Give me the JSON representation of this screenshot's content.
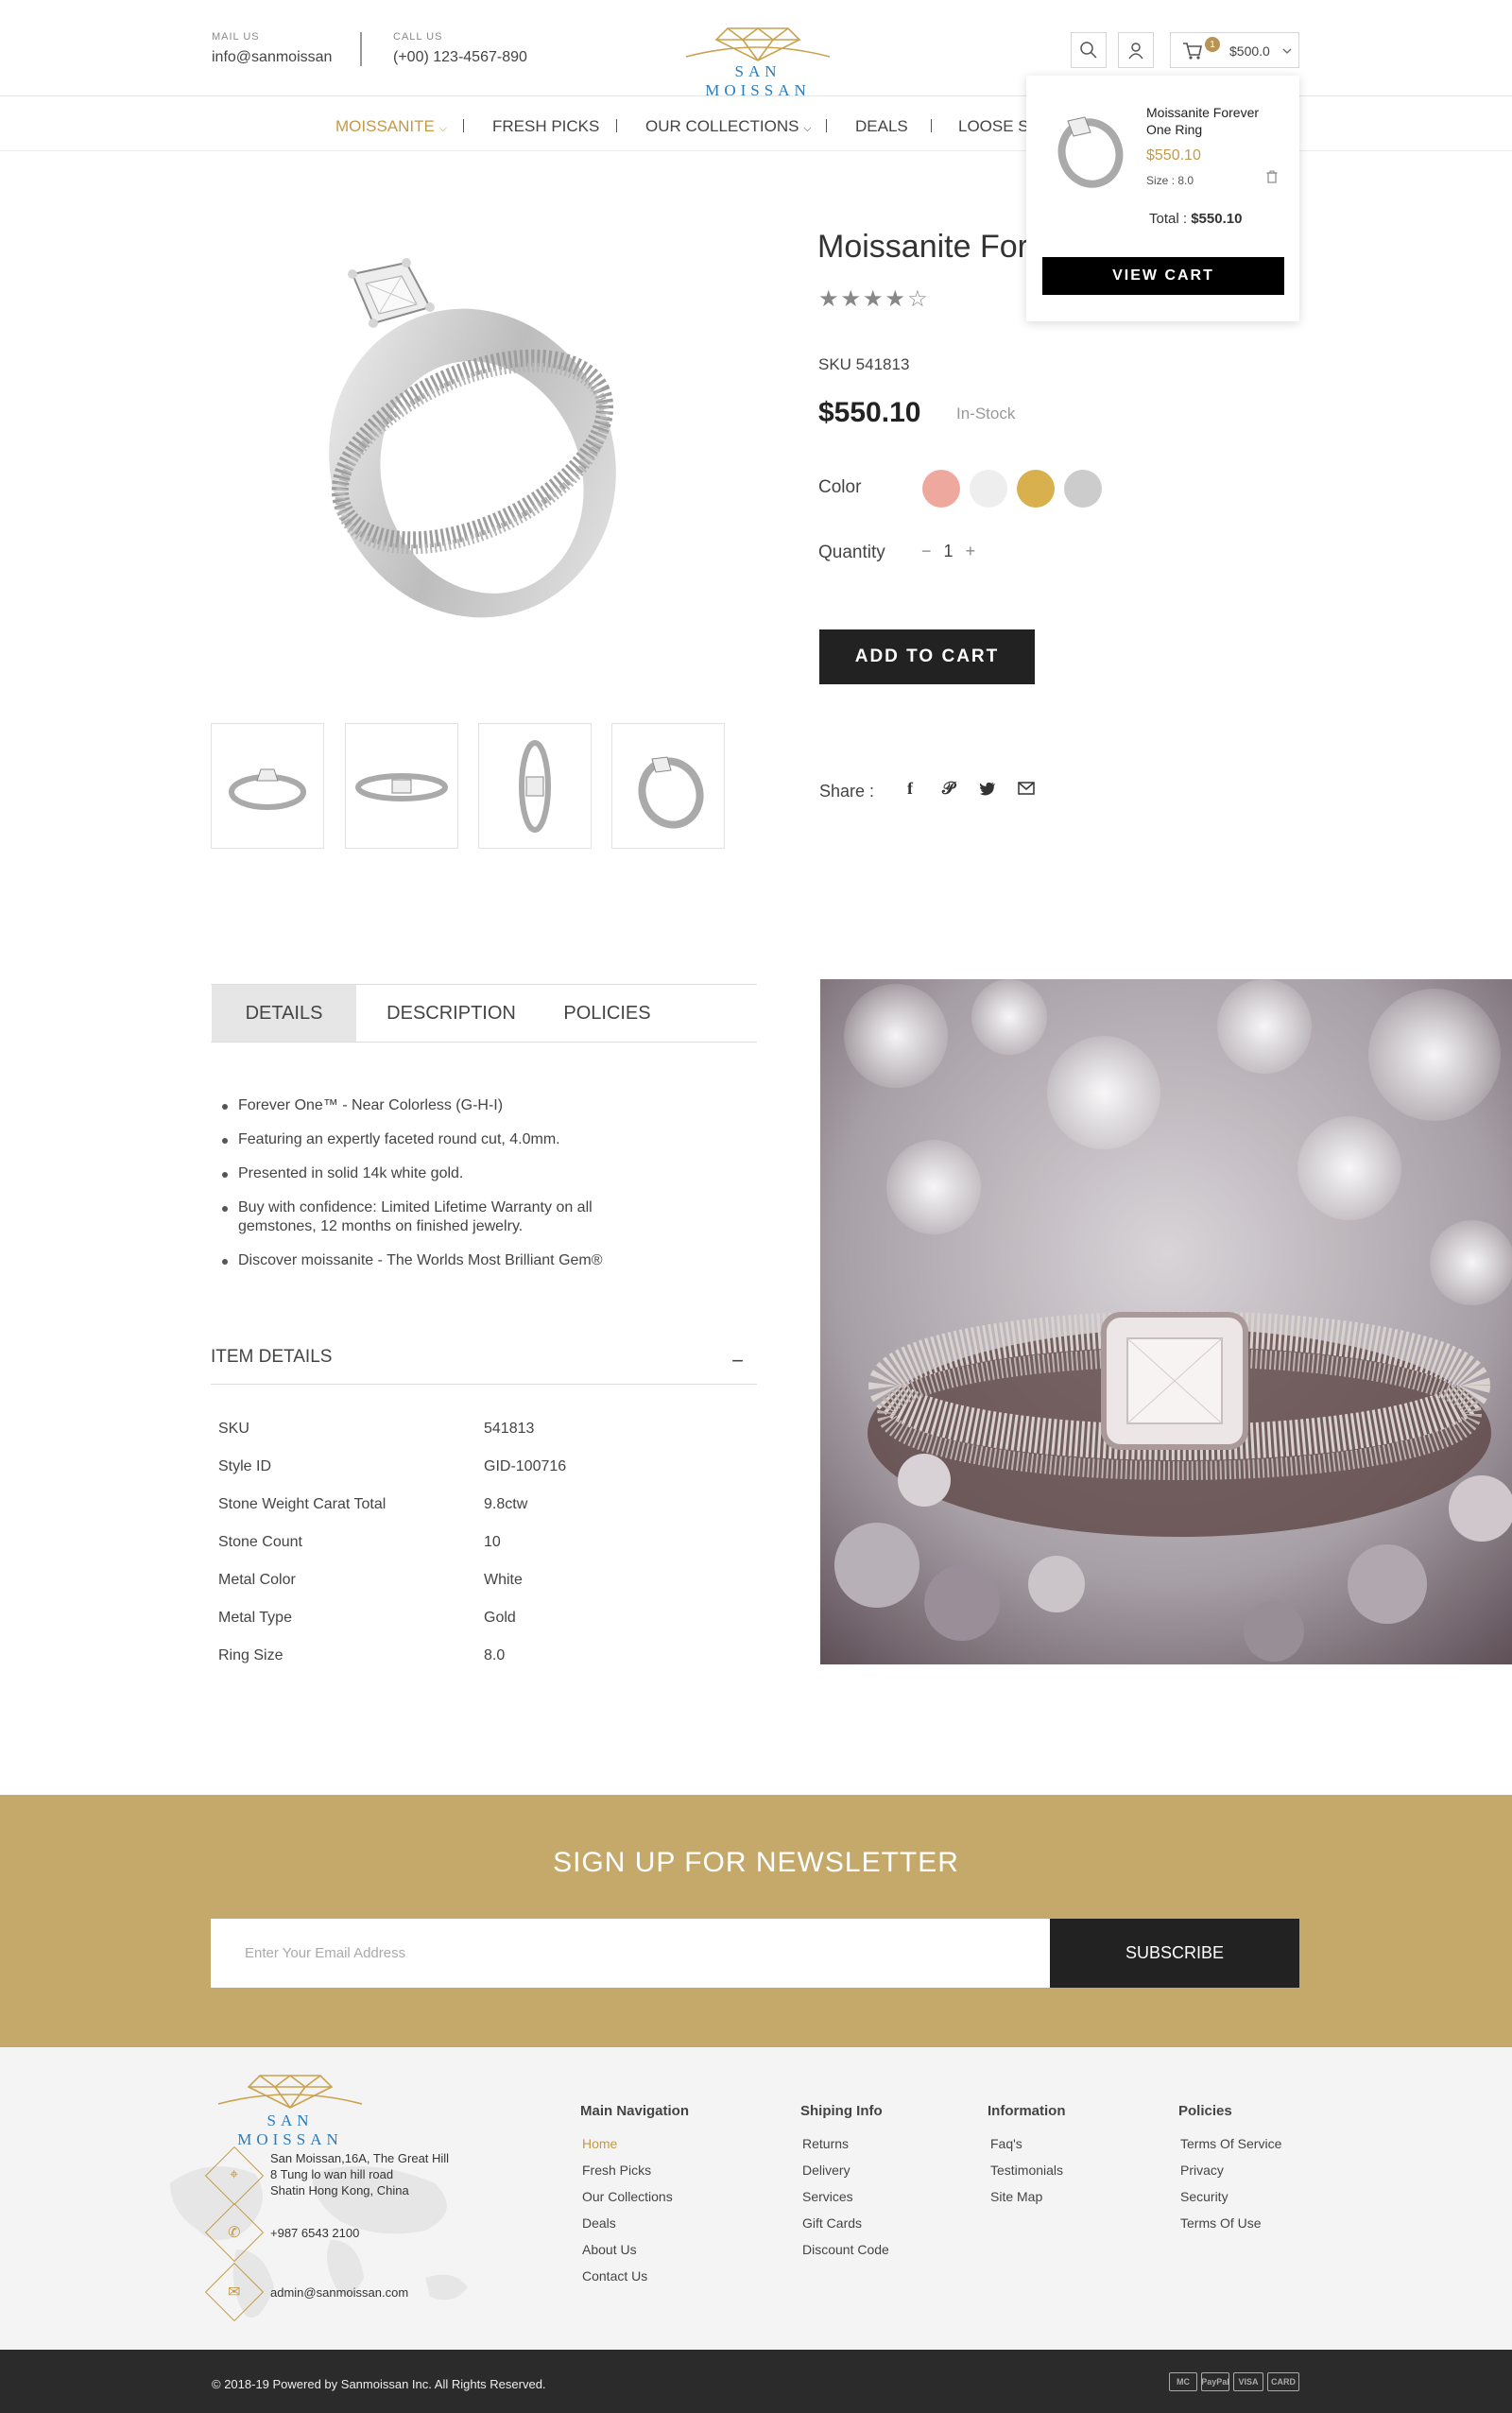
{
  "header": {
    "mail_label": "MAIL US",
    "mail_value": "info@sanmoissan",
    "call_label": "CALL US",
    "call_value": "(+00) 123-4567-890",
    "logo_text": "SAN MOISSAN",
    "cart_count": "1",
    "cart_amount": "$500.0"
  },
  "nav": {
    "items": [
      {
        "label": "MOISSANITE"
      },
      {
        "label": "FRESH PICKS"
      },
      {
        "label": "OUR COLLECTIONS"
      },
      {
        "label": "DEALS"
      },
      {
        "label": "LOOSE ST"
      }
    ]
  },
  "mini_cart": {
    "item_title": "Moissanite Forever One Ring",
    "item_price": "$550.10",
    "item_size": "Size : 8.0",
    "total_label": "Total :",
    "total_value": "$550.10",
    "button": "VIEW CART"
  },
  "product": {
    "title": "Moissanite Forever One Ring",
    "rating": 4,
    "rating_max": 5,
    "sku": "SKU 541813",
    "price": "$550.10",
    "stock": "In-Stock",
    "color_label": "Color",
    "colors": [
      "#eea89e",
      "#eeeeee",
      "#d9b04e",
      "#cccccc"
    ],
    "quantity_label": "Quantity",
    "quantity": "1",
    "add_to_cart": "ADD TO CART",
    "share_label": "Share :"
  },
  "tabs": [
    {
      "label": "DETAILS"
    },
    {
      "label": "DESCRIPTION"
    },
    {
      "label": "POLICIES"
    }
  ],
  "details_bullets": [
    "Forever One™ - Near Colorless (G-H-I)",
    "Featuring an expertly faceted round cut, 4.0mm.",
    "Presented in solid 14k white gold.",
    "Buy with confidence: Limited Lifetime Warranty on all gemstones, 12 months on finished jewelry.",
    "Discover moissanite - The Worlds Most Brilliant Gem®"
  ],
  "item_details": {
    "title": "ITEM DETAILS",
    "rows": [
      {
        "label": "SKU",
        "value": "541813"
      },
      {
        "label": "Style ID",
        "value": "GID-100716"
      },
      {
        "label": "Stone Weight Carat Total",
        "value": "9.8ctw"
      },
      {
        "label": "Stone Count",
        "value": "10"
      },
      {
        "label": "Metal Color",
        "value": "White"
      },
      {
        "label": "Metal Type",
        "value": "Gold"
      },
      {
        "label": "Ring Size",
        "value": "8.0"
      }
    ]
  },
  "newsletter": {
    "title": "SIGN UP FOR NEWSLETTER",
    "placeholder": "Enter Your Email Address",
    "button": "SUBSCRIBE"
  },
  "footer": {
    "logo_text": "SAN MOISSAN",
    "address": [
      "San Moissan,16A, The Great Hill",
      "8 Tung lo wan hill road",
      "Shatin Hong Kong, China"
    ],
    "phone": "+987 6543 2100",
    "email": "admin@sanmoissan.com",
    "columns": [
      {
        "title": "Main Navigation",
        "links": [
          "Home",
          "Fresh Picks",
          "Our Collections",
          "Deals",
          "About Us",
          "Contact Us"
        ]
      },
      {
        "title": "Shiping Info",
        "links": [
          "Returns",
          "Delivery",
          "Services",
          "Gift Cards",
          "Discount Code"
        ]
      },
      {
        "title": "Information",
        "links": [
          "Faq's",
          "Testimonials",
          "Site Map"
        ]
      },
      {
        "title": "Policies",
        "links": [
          "Terms Of Service",
          "Privacy",
          "Security",
          "Terms Of Use"
        ]
      }
    ],
    "copyright": "© 2018-19 Powered by Sanmoissan Inc. All Rights Reserved.",
    "payments": [
      "MC",
      "PayPal",
      "VISA",
      "CARD"
    ]
  }
}
